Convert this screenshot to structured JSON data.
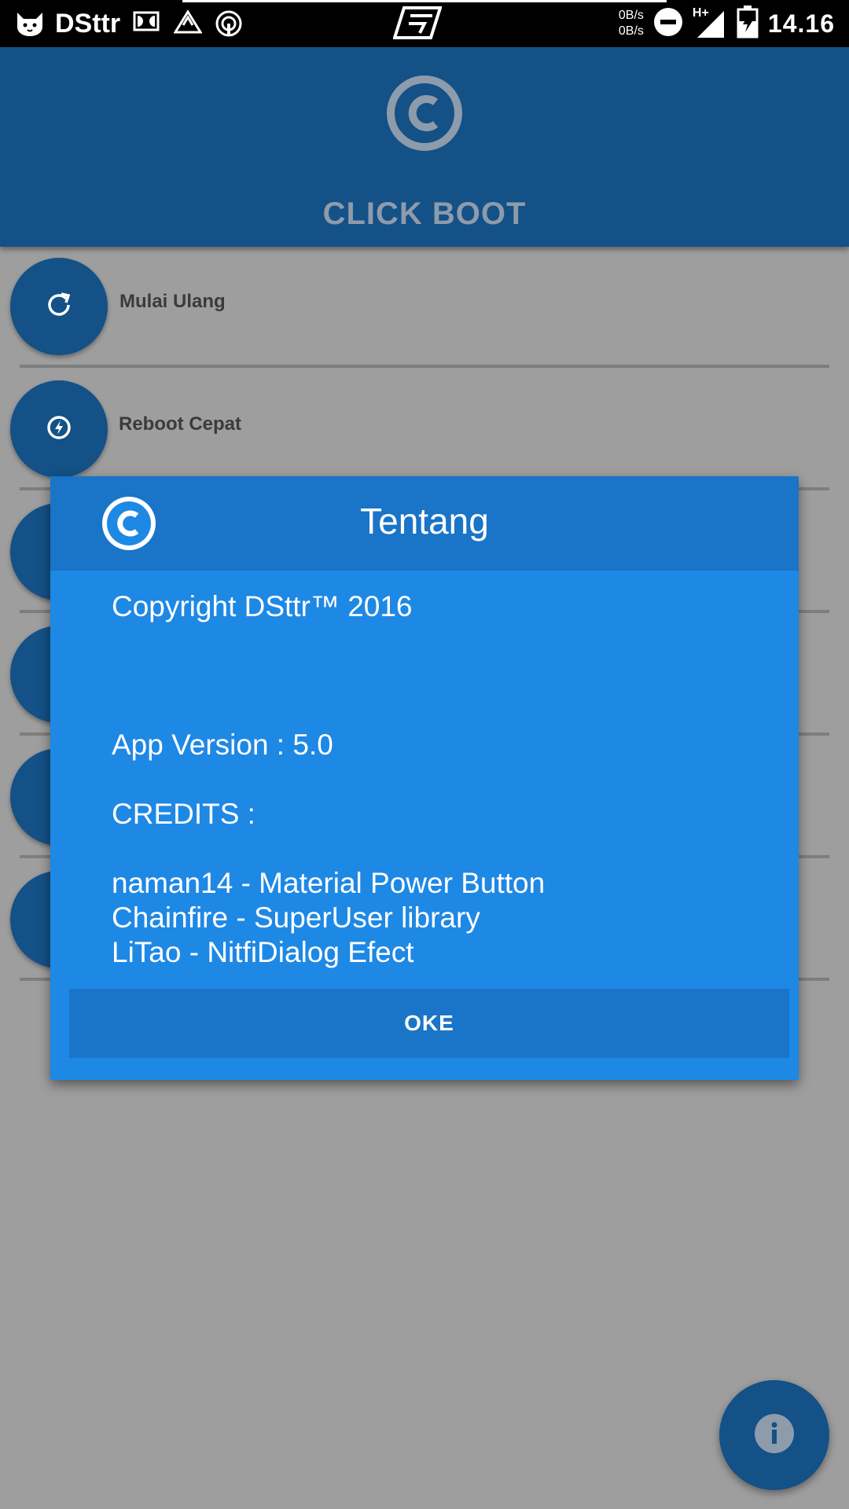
{
  "status_bar": {
    "app_name": "DSttr",
    "net_up": "0B/s",
    "net_down": "0B/s",
    "network_type": "H+",
    "time": "14.16"
  },
  "app": {
    "title": "CLICK BOOT"
  },
  "list": {
    "items": [
      {
        "label": "Mulai Ulang",
        "icon": "restart-icon"
      },
      {
        "label": "Reboot Cepat",
        "icon": "fast-reboot-icon"
      },
      {
        "label": "",
        "icon": "power-icon"
      },
      {
        "label": "",
        "icon": "power-icon"
      },
      {
        "label": "",
        "icon": "power-icon"
      },
      {
        "label": "",
        "icon": "power-icon"
      }
    ]
  },
  "dialog": {
    "title": "Tentang",
    "copyright": "Copyright DSttr™ 2016",
    "version": "App Version : 5.0",
    "credits_heading": "CREDITS :",
    "credits": [
      "naman14 - Material Power Button",
      "Chainfire - SuperUser library",
      "LiTao - NitfiDialog Efect"
    ],
    "ok_label": "OKE"
  },
  "colors": {
    "status_bar": "#000000",
    "app_bar": "#135187",
    "dialog": "#1e88e5",
    "dialog_header": "#1a74c8",
    "scrim": "#9e9e9e"
  }
}
